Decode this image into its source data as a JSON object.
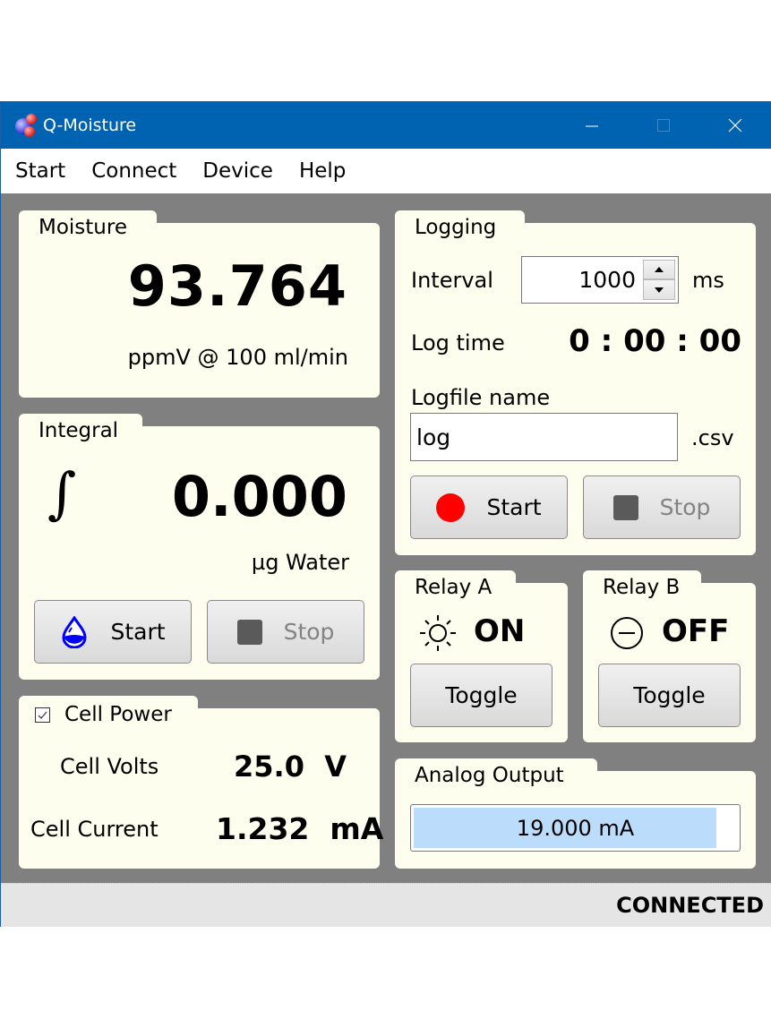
{
  "window": {
    "title": "Q-Moisture",
    "icon": "molecule-icon",
    "controls": {
      "minimize": "minimize-icon",
      "maximize": "maximize-icon",
      "close": "close-icon"
    }
  },
  "menu": [
    "Start",
    "Connect",
    "Device",
    "Help"
  ],
  "moisture": {
    "title": "Moisture",
    "value": "93.764",
    "unit": "ppmV @ 100 ml/min"
  },
  "integral": {
    "title": "Integral",
    "symbol": "∫",
    "value": "0.000",
    "unit": "µg Water",
    "start_label": "Start",
    "start_icon": "water-drop-icon",
    "stop_label": "Stop",
    "stop_icon": "stop-square-icon",
    "stop_enabled": false
  },
  "cell_power": {
    "title": "Cell Power",
    "checked": true,
    "volts_label": "Cell Volts",
    "volts_value": "25.0  V",
    "current_label": "Cell Current",
    "current_value": "1.232  mA"
  },
  "logging": {
    "title": "Logging",
    "interval_label": "Interval",
    "interval_value": "1000",
    "interval_unit": "ms",
    "logtime_label": "Log time",
    "logtime_value": "0 : 00 : 00",
    "filename_label": "Logfile name",
    "filename_value": "log",
    "filename_ext": ".csv",
    "start_label": "Start",
    "start_icon": "record-icon",
    "stop_label": "Stop",
    "stop_icon": "stop-square-icon",
    "stop_enabled": false
  },
  "relay_a": {
    "title": "Relay A",
    "state": "ON",
    "state_icon": "sun-icon",
    "toggle_label": "Toggle"
  },
  "relay_b": {
    "title": "Relay B",
    "state": "OFF",
    "state_icon": "minus-circle-icon",
    "toggle_label": "Toggle"
  },
  "analog_output": {
    "title": "Analog Output",
    "text": "19.000 mA",
    "value_mA": 19.0,
    "range_mA": [
      4,
      20
    ]
  },
  "status": {
    "text": "CONNECTED"
  },
  "colors": {
    "titlebar": "#0063b1",
    "panel_bg": "#fefeee",
    "workspace": "#808080",
    "progress_fill": "#bcdcfb",
    "record_red": "#ff0000",
    "drop_blue": "#0000ff"
  }
}
